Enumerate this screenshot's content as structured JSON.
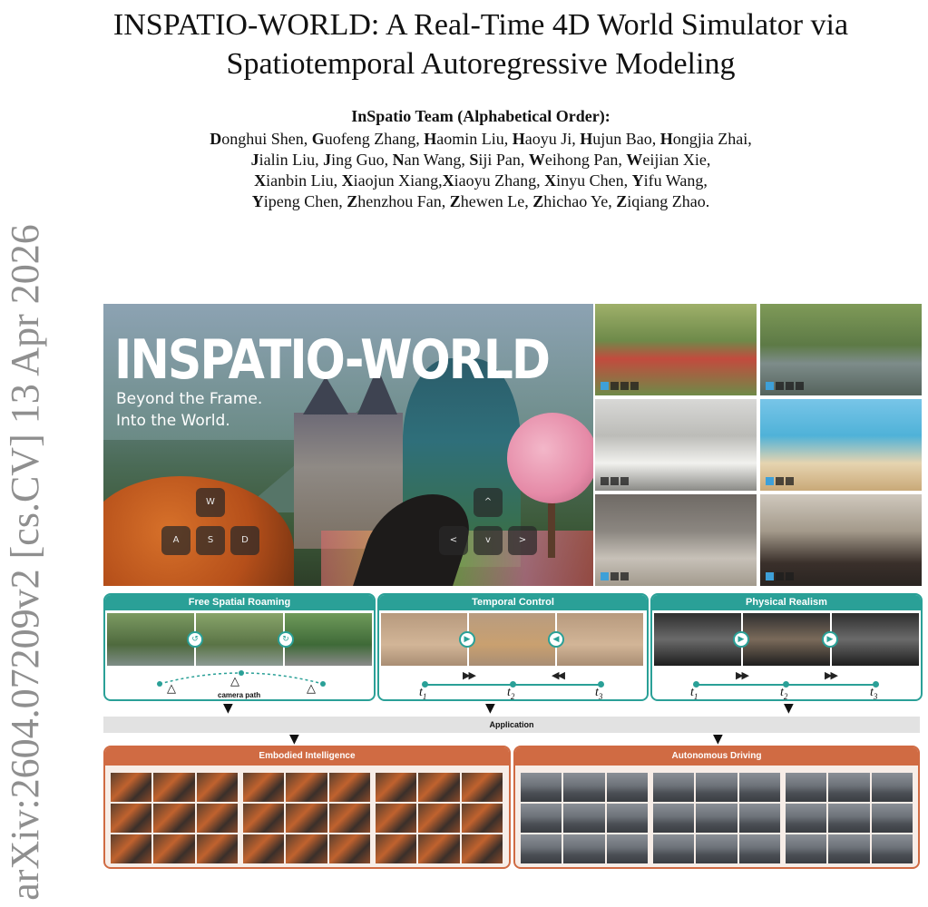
{
  "side_stamp": "arXiv:2604.07209v2  [cs.CV]  13 Apr 2026",
  "title": {
    "line1_a": "I",
    "line1_b": "N",
    "line1_c": "S",
    "line1_d": "PATIO",
    "line1_e": "-W",
    "line1_f": "ORLD",
    "line1_rest": ": A Real-Time 4D World Simulator via",
    "line2": "Spatiotemporal Autoregressive Modeling"
  },
  "team": "InSpatio Team (Alphabetical Order):",
  "authors": [
    {
      "initial": "D",
      "rest": "onghui Shen, "
    },
    {
      "initial": "G",
      "rest": "uofeng Zhang, "
    },
    {
      "initial": "H",
      "rest": "aomin Liu, "
    },
    {
      "initial": "H",
      "rest": "aoyu Ji, "
    },
    {
      "initial": "H",
      "rest": "ujun Bao, "
    },
    {
      "initial": "H",
      "rest": "ongjia Zhai,"
    },
    {
      "initial": "J",
      "rest": "ialin Liu, "
    },
    {
      "initial": "J",
      "rest": "ing Guo, "
    },
    {
      "initial": "N",
      "rest": "an Wang, "
    },
    {
      "initial": "S",
      "rest": "iji Pan, "
    },
    {
      "initial": "W",
      "rest": "eihong Pan, "
    },
    {
      "initial": "W",
      "rest": "eijian Xie,"
    },
    {
      "initial": "X",
      "rest": "ianbin Liu, "
    },
    {
      "initial": "X",
      "rest": "iaojun Xiang,"
    },
    {
      "initial": "X",
      "rest": "iaoyu Zhang, "
    },
    {
      "initial": "X",
      "rest": "inyu Chen, "
    },
    {
      "initial": "Y",
      "rest": "ifu Wang,"
    },
    {
      "initial": "Y",
      "rest": "ipeng Chen, "
    },
    {
      "initial": "Z",
      "rest": "henzhou Fan, "
    },
    {
      "initial": "Z",
      "rest": "hewen Le, "
    },
    {
      "initial": "Z",
      "rest": "hichao Ye, "
    },
    {
      "initial": "Z",
      "rest": "iqiang Zhao."
    }
  ],
  "hero": {
    "brand": "INSPATIO-WORLD",
    "tagline_1": "Beyond the Frame.",
    "tagline_2": "Into the World.",
    "keys_left": {
      "w": "W",
      "a": "A",
      "s": "S",
      "d": "D"
    },
    "keys_right": {
      "up": "^",
      "left": "<",
      "down": "v",
      "right": ">"
    }
  },
  "panels": {
    "roaming": {
      "title": "Free Spatial Roaming",
      "camera_path": "camera path"
    },
    "temporal": {
      "title": "Temporal Control",
      "ff": "▶▶",
      "rw": "◀◀"
    },
    "physical": {
      "title": "Physical Realism",
      "ff": "▶▶"
    },
    "times": {
      "t": "t",
      "s1": "1",
      "s2": "2",
      "s3": "3"
    }
  },
  "application": "Application",
  "applications": {
    "embodied": "Embodied Intelligence",
    "driving": "Autonomous Driving"
  },
  "colors": {
    "teal": "#2aa097",
    "orange": "#d06b43"
  }
}
